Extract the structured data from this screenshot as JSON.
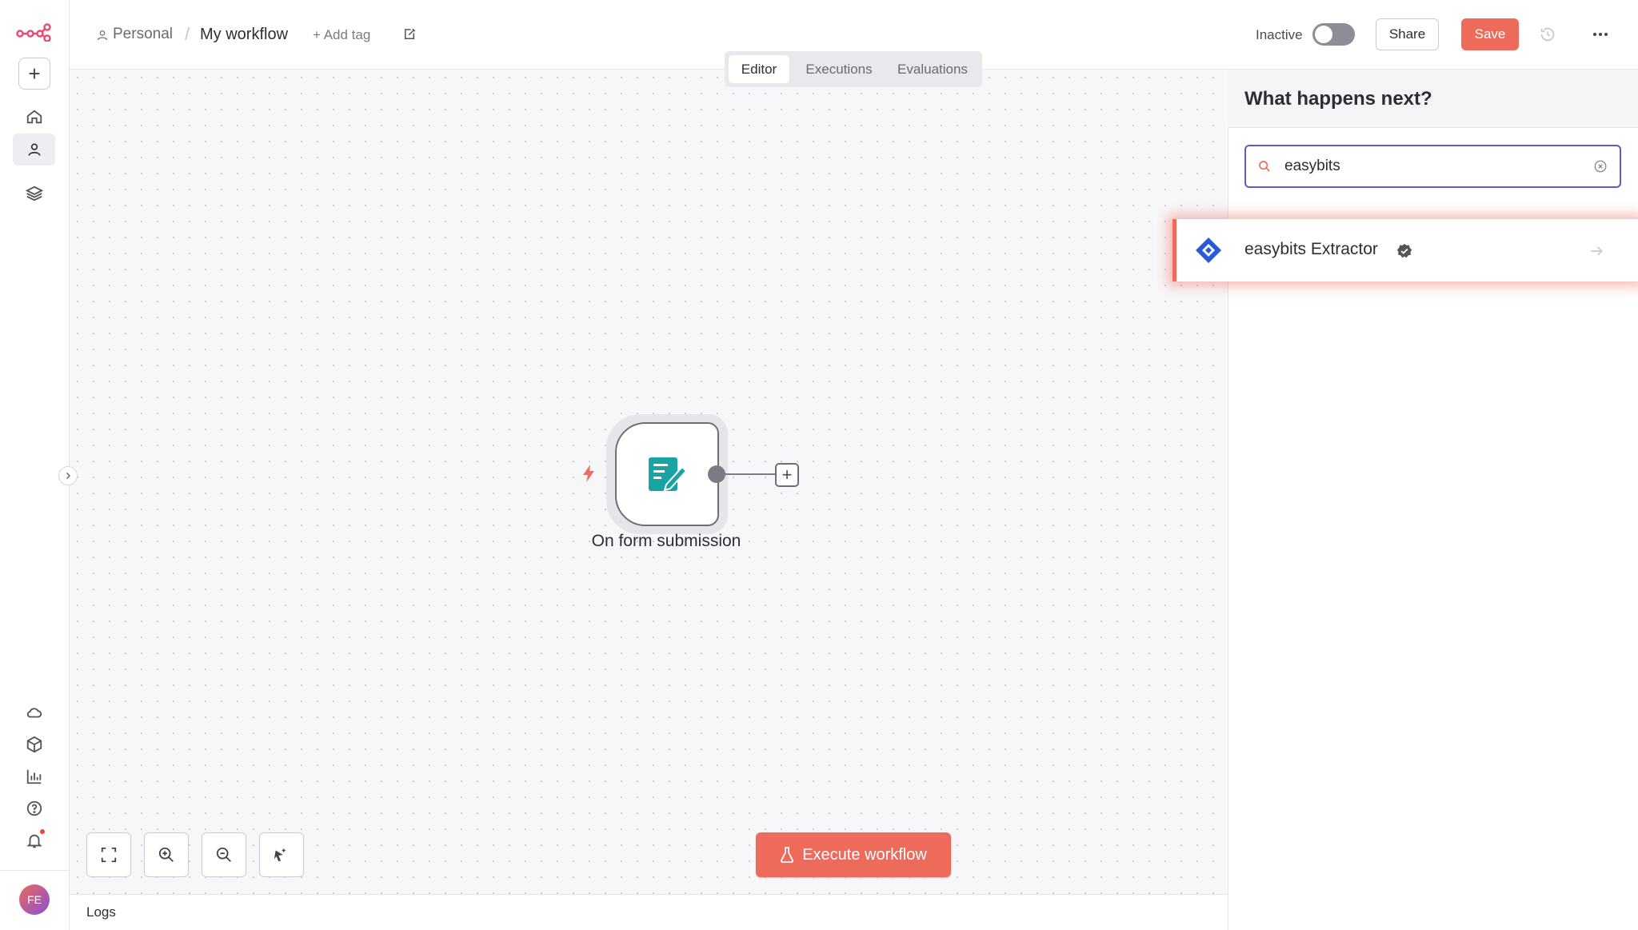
{
  "app": {
    "avatar_initials": "FE"
  },
  "breadcrumb": {
    "project": "Personal",
    "separator": "/",
    "workflow_name": "My workflow",
    "add_tag": "+ Add tag"
  },
  "header": {
    "status_label": "Inactive",
    "active": false,
    "share_label": "Share",
    "save_label": "Save"
  },
  "tabs": [
    {
      "label": "Editor",
      "selected": true
    },
    {
      "label": "Executions",
      "selected": false
    },
    {
      "label": "Evaluations",
      "selected": false
    }
  ],
  "canvas": {
    "trigger_node_label": "On form submission",
    "execute_label": "Execute workflow"
  },
  "logs": {
    "label": "Logs"
  },
  "panel": {
    "title": "What happens next?",
    "search_value": "easybits",
    "results": [
      {
        "label": "easybits Extractor",
        "verified": true
      }
    ]
  },
  "icons": {
    "rail": [
      "n8n-logo-icon",
      "plus-icon",
      "home-icon",
      "person-icon",
      "layers-icon",
      "cloud-icon",
      "box-icon",
      "chart-icon",
      "help-icon",
      "bell-icon"
    ],
    "canvas_controls": [
      "fit-view-icon",
      "zoom-in-icon",
      "zoom-out-icon",
      "tidy-up-icon"
    ]
  },
  "colors": {
    "accent": "#ee6b5c",
    "focus": "#5d5cc4",
    "node_icon": "#1aa3a3",
    "result_icon": "#2a5bd7"
  }
}
